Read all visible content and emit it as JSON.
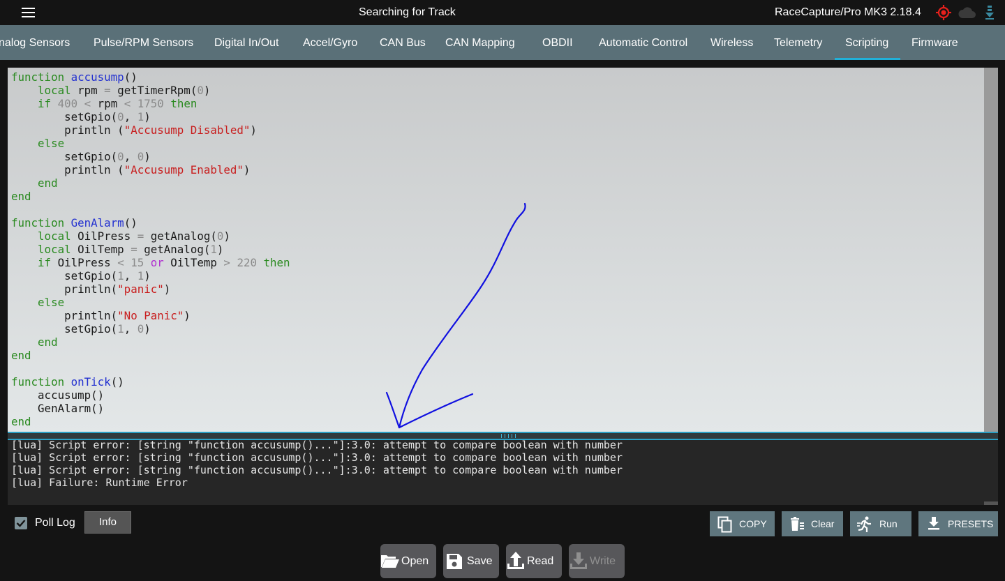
{
  "header": {
    "status_title": "Searching for Track",
    "device_title": "RaceCapture/Pro MK3 2.18.4",
    "icons": [
      "menu-icon",
      "gps-target-icon",
      "cloud-icon",
      "download-icon"
    ],
    "gps_color": "#e8201c"
  },
  "tabs": [
    {
      "label": "nalog Sensors"
    },
    {
      "label": "Pulse/RPM Sensors"
    },
    {
      "label": "Digital In/Out"
    },
    {
      "label": "Accel/Gyro"
    },
    {
      "label": "CAN Bus"
    },
    {
      "label": "CAN Mapping"
    },
    {
      "label": "OBDII"
    },
    {
      "label": "Automatic Control"
    },
    {
      "label": "Wireless"
    },
    {
      "label": "Telemetry"
    },
    {
      "label": "Scripting",
      "active": true
    },
    {
      "label": "Firmware"
    }
  ],
  "accent_color": "#20b0d8",
  "editor": {
    "language": "lua",
    "code": "function accusump()\n    local rpm = getTimerRpm(0)\n    if 400 < rpm < 1750 then\n        setGpio(0, 1)\n        println (\"Accusump Disabled\")\n    else\n        setGpio(0, 0)\n        println (\"Accusump Enabled\")\n    end\nend\n\nfunction GenAlarm()\n    local OilPress = getAnalog(0)\n    local OilTemp = getAnalog(1)\n    if OilPress < 15 or OilTemp > 220 then\n        setGpio(1, 1)\n        println(\"panic\")\n    else\n        println(\"No Panic\")\n        setGpio(1, 0)\n    end\nend\n\nfunction onTick()\n    accusump()\n    GenAlarm()\nend"
  },
  "console": {
    "lines": [
      "[lua] Script error: [string \"function accusump()...\"]:3.0: attempt to compare boolean with number",
      "[lua] Script error: [string \"function accusump()...\"]:3.0: attempt to compare boolean with number",
      "[lua] Script error: [string \"function accusump()...\"]:3.0: attempt to compare boolean with number",
      "[lua] Failure: Runtime Error"
    ]
  },
  "controls": {
    "poll_log_label": "Poll Log",
    "poll_log_checked": true,
    "info_label": "Info",
    "copy_label": "COPY",
    "clear_label": "Clear",
    "run_label": "Run",
    "presets_label": "PRESETS"
  },
  "file_buttons": {
    "open_label": "Open",
    "save_label": "Save",
    "read_label": "Read",
    "write_label": "Write",
    "write_disabled": true
  },
  "annotation": {
    "type": "hand-drawn arrow",
    "color": "#1010e0"
  }
}
